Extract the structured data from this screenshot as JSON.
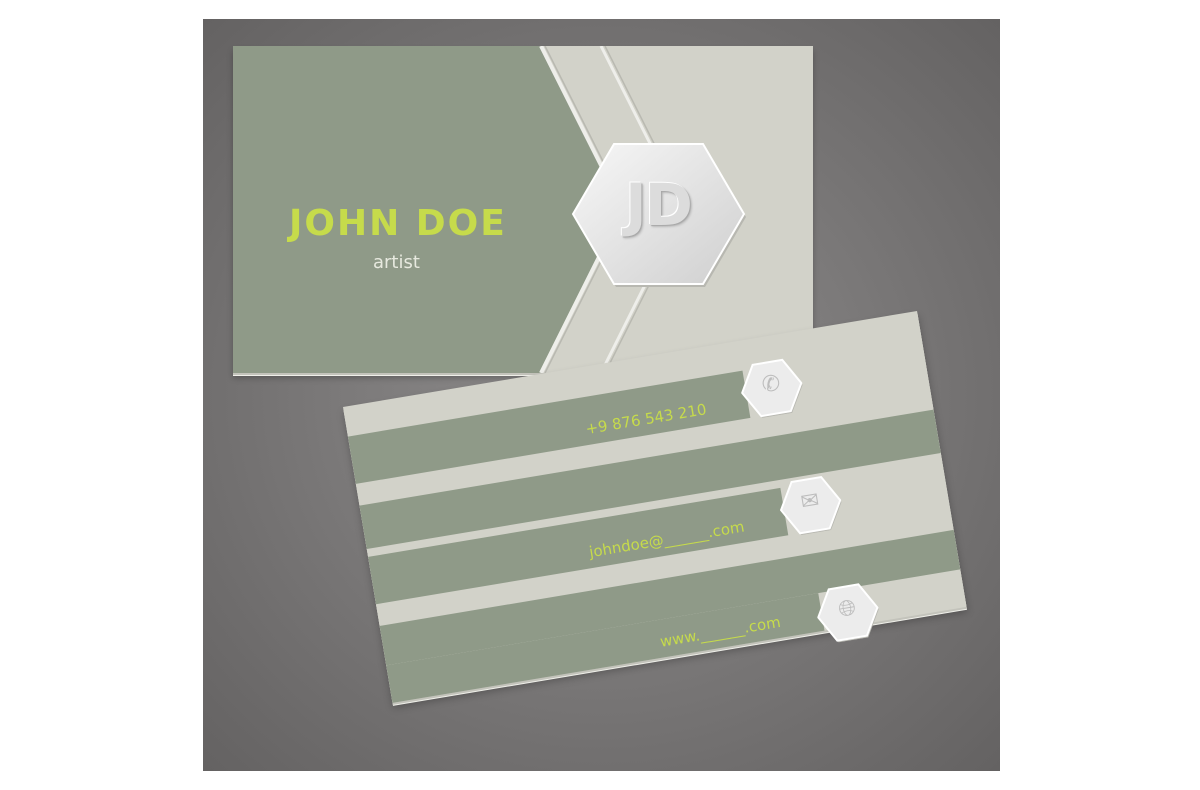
{
  "front_card": {
    "name": "JOHN DOE",
    "title": "artist",
    "monogram": "JD"
  },
  "back_card": {
    "contacts": [
      {
        "type": "phone",
        "icon": "phone-icon",
        "text": "+9  876 543 210"
      },
      {
        "type": "email",
        "icon": "envelope-icon",
        "text": "johndoe@______.com"
      },
      {
        "type": "web",
        "icon": "globe-icon",
        "text": "www.______.com"
      }
    ]
  },
  "colors": {
    "card_green": "#8f9a88",
    "card_light": "#d2d2c9",
    "accent_lime": "#c6db4b",
    "background_gray": "#7c7a7a"
  }
}
